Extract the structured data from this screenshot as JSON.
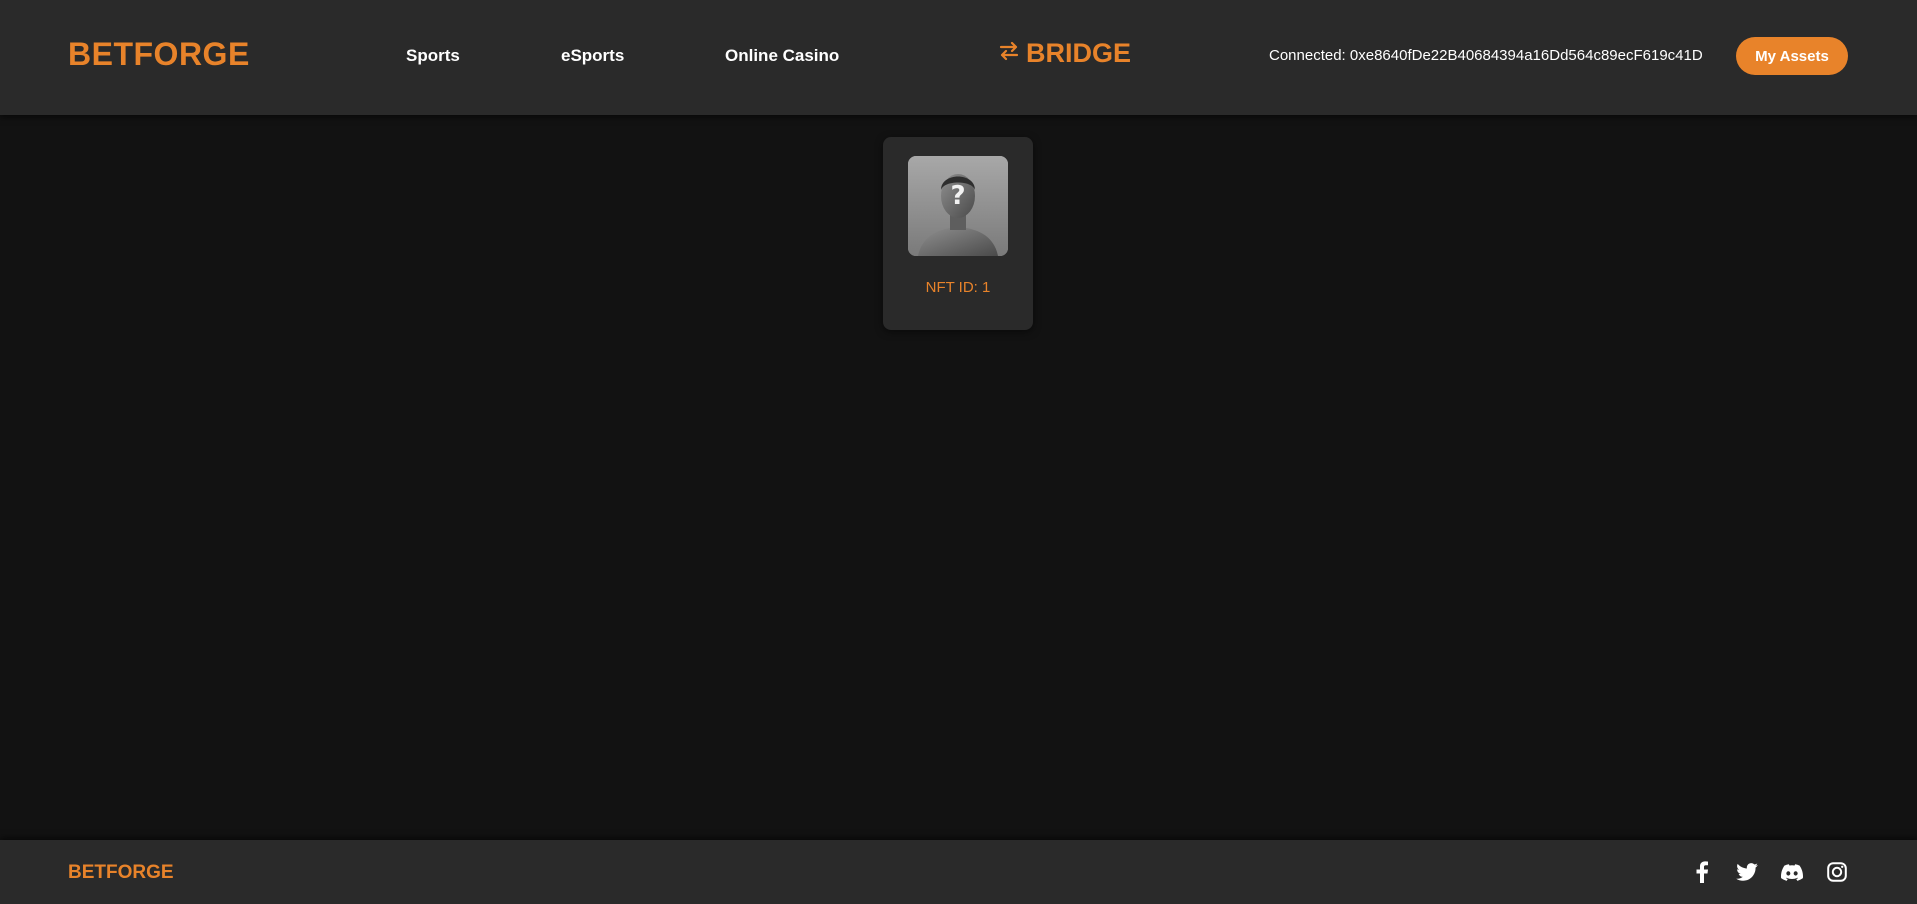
{
  "header": {
    "logo": "BETFORGE",
    "nav": [
      {
        "label": "Sports"
      },
      {
        "label": "eSports"
      },
      {
        "label": "Online Casino"
      }
    ],
    "bridge": {
      "label": "BRIDGE",
      "icon": "swap-arrows-icon"
    },
    "connected_text": "Connected: 0xe8640fDe22B40684394a16Dd564c89ecF619c41D",
    "my_assets_label": "My Assets"
  },
  "nfts": [
    {
      "id_label": "NFT ID: 1",
      "image": "mystery-avatar"
    }
  ],
  "footer": {
    "logo": "BETFORGE",
    "social": [
      "facebook-icon",
      "twitter-icon",
      "discord-icon",
      "instagram-icon"
    ]
  },
  "colors": {
    "accent": "#e8832a",
    "header_bg": "#2a2a2a",
    "page_bg": "#121212",
    "card_bg": "#2a2a2a"
  }
}
